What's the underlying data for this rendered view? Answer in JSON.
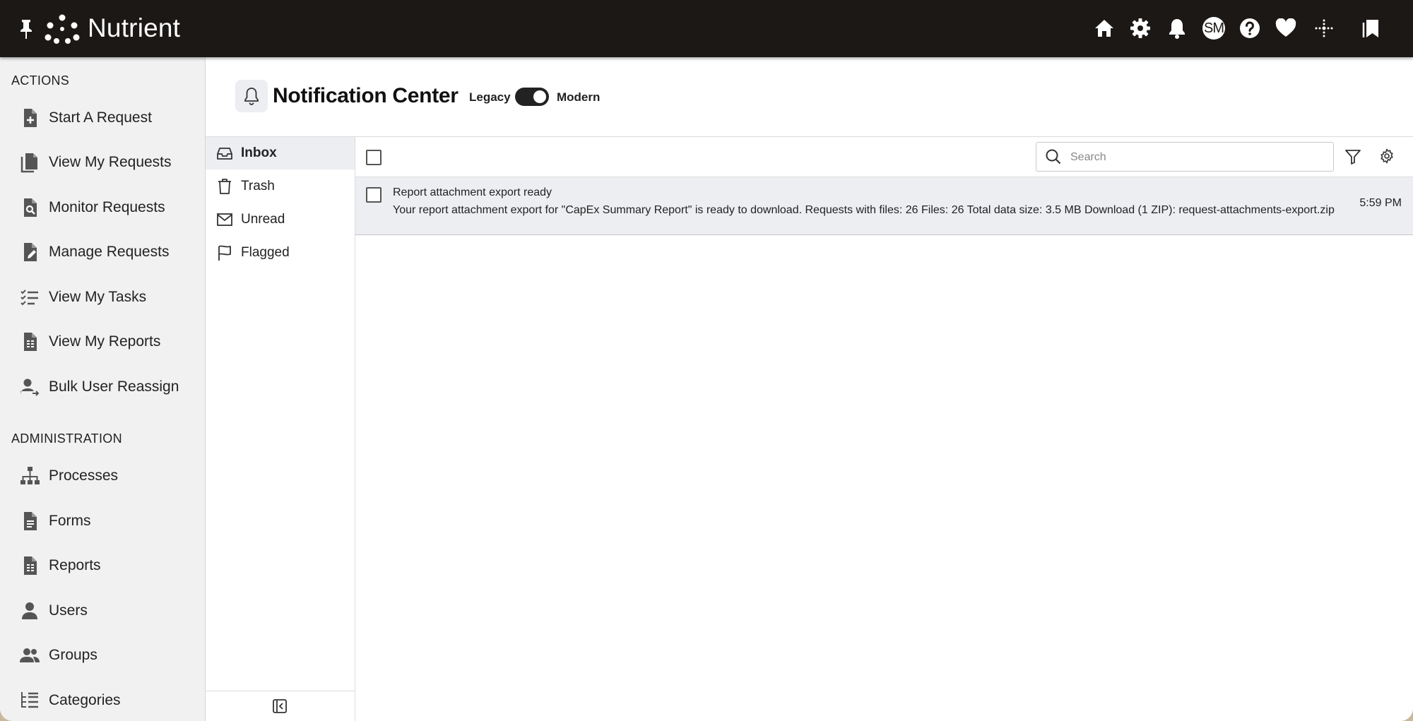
{
  "app": {
    "brand": "Nutrient",
    "user_initials": "SM"
  },
  "topbar": {
    "icons": [
      "pin-icon",
      "home-icon",
      "settings-icon",
      "bell-icon",
      "avatar",
      "help-icon",
      "heart-icon",
      "sparkle-icon",
      "bookmarks-icon"
    ]
  },
  "sidebar": {
    "actions_heading": "ACTIONS",
    "actions": [
      {
        "label": "Start A Request",
        "icon": "file-plus-icon"
      },
      {
        "label": "View My Requests",
        "icon": "files-icon"
      },
      {
        "label": "Monitor Requests",
        "icon": "file-search-icon"
      },
      {
        "label": "Manage Requests",
        "icon": "file-edit-icon"
      },
      {
        "label": "View My Tasks",
        "icon": "task-list-icon"
      },
      {
        "label": "View My Reports",
        "icon": "report-icon"
      },
      {
        "label": "Bulk User Reassign",
        "icon": "user-reassign-icon"
      }
    ],
    "admin_heading": "ADMINISTRATION",
    "admin": [
      {
        "label": "Processes",
        "icon": "hierarchy-icon"
      },
      {
        "label": "Forms",
        "icon": "form-icon"
      },
      {
        "label": "Reports",
        "icon": "report-icon"
      },
      {
        "label": "Users",
        "icon": "user-icon"
      },
      {
        "label": "Groups",
        "icon": "group-icon"
      },
      {
        "label": "Categories",
        "icon": "categories-icon"
      }
    ]
  },
  "header": {
    "title": "Notification Center",
    "toggle_left": "Legacy",
    "toggle_right": "Modern",
    "toggle_on": true
  },
  "folders": [
    {
      "label": "Inbox",
      "icon": "inbox-icon",
      "active": true
    },
    {
      "label": "Trash",
      "icon": "trash-icon",
      "active": false
    },
    {
      "label": "Unread",
      "icon": "envelope-icon",
      "active": false
    },
    {
      "label": "Flagged",
      "icon": "flag-icon",
      "active": false
    }
  ],
  "search": {
    "placeholder": "Search",
    "value": ""
  },
  "notifications": [
    {
      "subject": "Report attachment export ready",
      "body": "Your report attachment export for \"CapEx Summary Report\" is ready to download. Requests with files: 26 Files: 26 Total data size: 3.5 MB Download (1 ZIP): request-attachments-export.zip",
      "time": "5:59 PM"
    }
  ],
  "colors": {
    "topbar": "#1c1816",
    "sidebar": "#f1f1f1",
    "selected": "#eceef1"
  }
}
